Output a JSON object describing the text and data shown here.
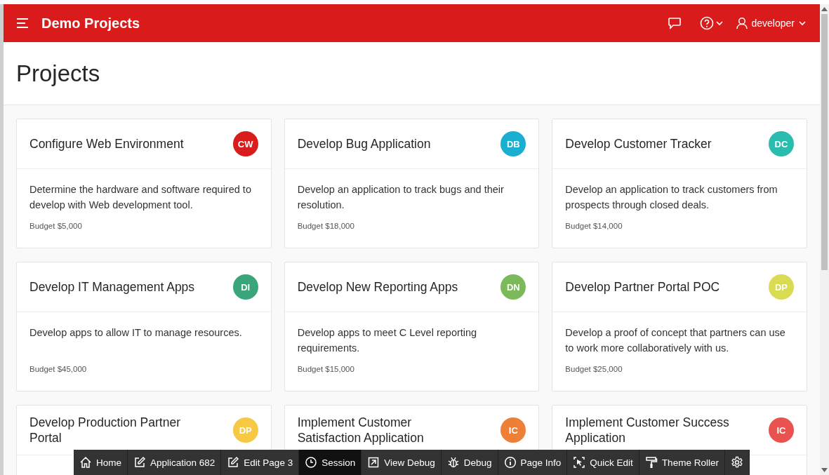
{
  "header": {
    "app_title": "Demo Projects",
    "user": "developer"
  },
  "page_title": "Projects",
  "cards": [
    {
      "title": "Configure Web Environment",
      "initials": "CW",
      "color": "#d91c1c",
      "description": "Determine the hardware and software required to develop with Web development tool.",
      "budget": "Budget $5,000"
    },
    {
      "title": "Develop Bug Application",
      "initials": "DB",
      "color": "#1aaed0",
      "description": "Develop an application to track bugs and their resolution.",
      "budget": "Budget $18,000"
    },
    {
      "title": "Develop Customer Tracker",
      "initials": "DC",
      "color": "#2bbcb0",
      "description": "Develop an application to track customers from prospects through closed deals.",
      "budget": "Budget $14,000"
    },
    {
      "title": "Develop IT Management Apps",
      "initials": "DI",
      "color": "#3aa57a",
      "description": "Develop apps to allow IT to manage resources.",
      "budget": "Budget $45,000"
    },
    {
      "title": "Develop New Reporting Apps",
      "initials": "DN",
      "color": "#7cb95a",
      "description": "Develop apps to meet C Level reporting requirements.",
      "budget": "Budget $15,000"
    },
    {
      "title": "Develop Partner Portal POC",
      "initials": "DP",
      "color": "#d9dc52",
      "description": "Develop a proof of concept that partners can use to work more collaboratively with us.",
      "budget": "Budget $25,000"
    },
    {
      "title": "Develop Production Partner Portal",
      "initials": "DP",
      "color": "#f6c843"
    },
    {
      "title": "Implement Customer Satisfaction Application",
      "initials": "IC",
      "color": "#ee7f36"
    },
    {
      "title": "Implement Customer Success Application",
      "initials": "IC",
      "color": "#e8524f"
    }
  ],
  "dev_toolbar": [
    {
      "kind": "home",
      "label": "Home",
      "selected": false
    },
    {
      "kind": "edit",
      "label": "Application 682",
      "selected": false
    },
    {
      "kind": "edit",
      "label": "Edit Page 3",
      "selected": false
    },
    {
      "kind": "clock",
      "label": "Session",
      "selected": true
    },
    {
      "kind": "view",
      "label": "View Debug",
      "selected": false
    },
    {
      "kind": "bug",
      "label": "Debug",
      "selected": false
    },
    {
      "kind": "info",
      "label": "Page Info",
      "selected": false
    },
    {
      "kind": "cursor",
      "label": "Quick Edit",
      "selected": false
    },
    {
      "kind": "roller",
      "label": "Theme Roller",
      "selected": false
    },
    {
      "kind": "gear",
      "selected": false
    }
  ]
}
